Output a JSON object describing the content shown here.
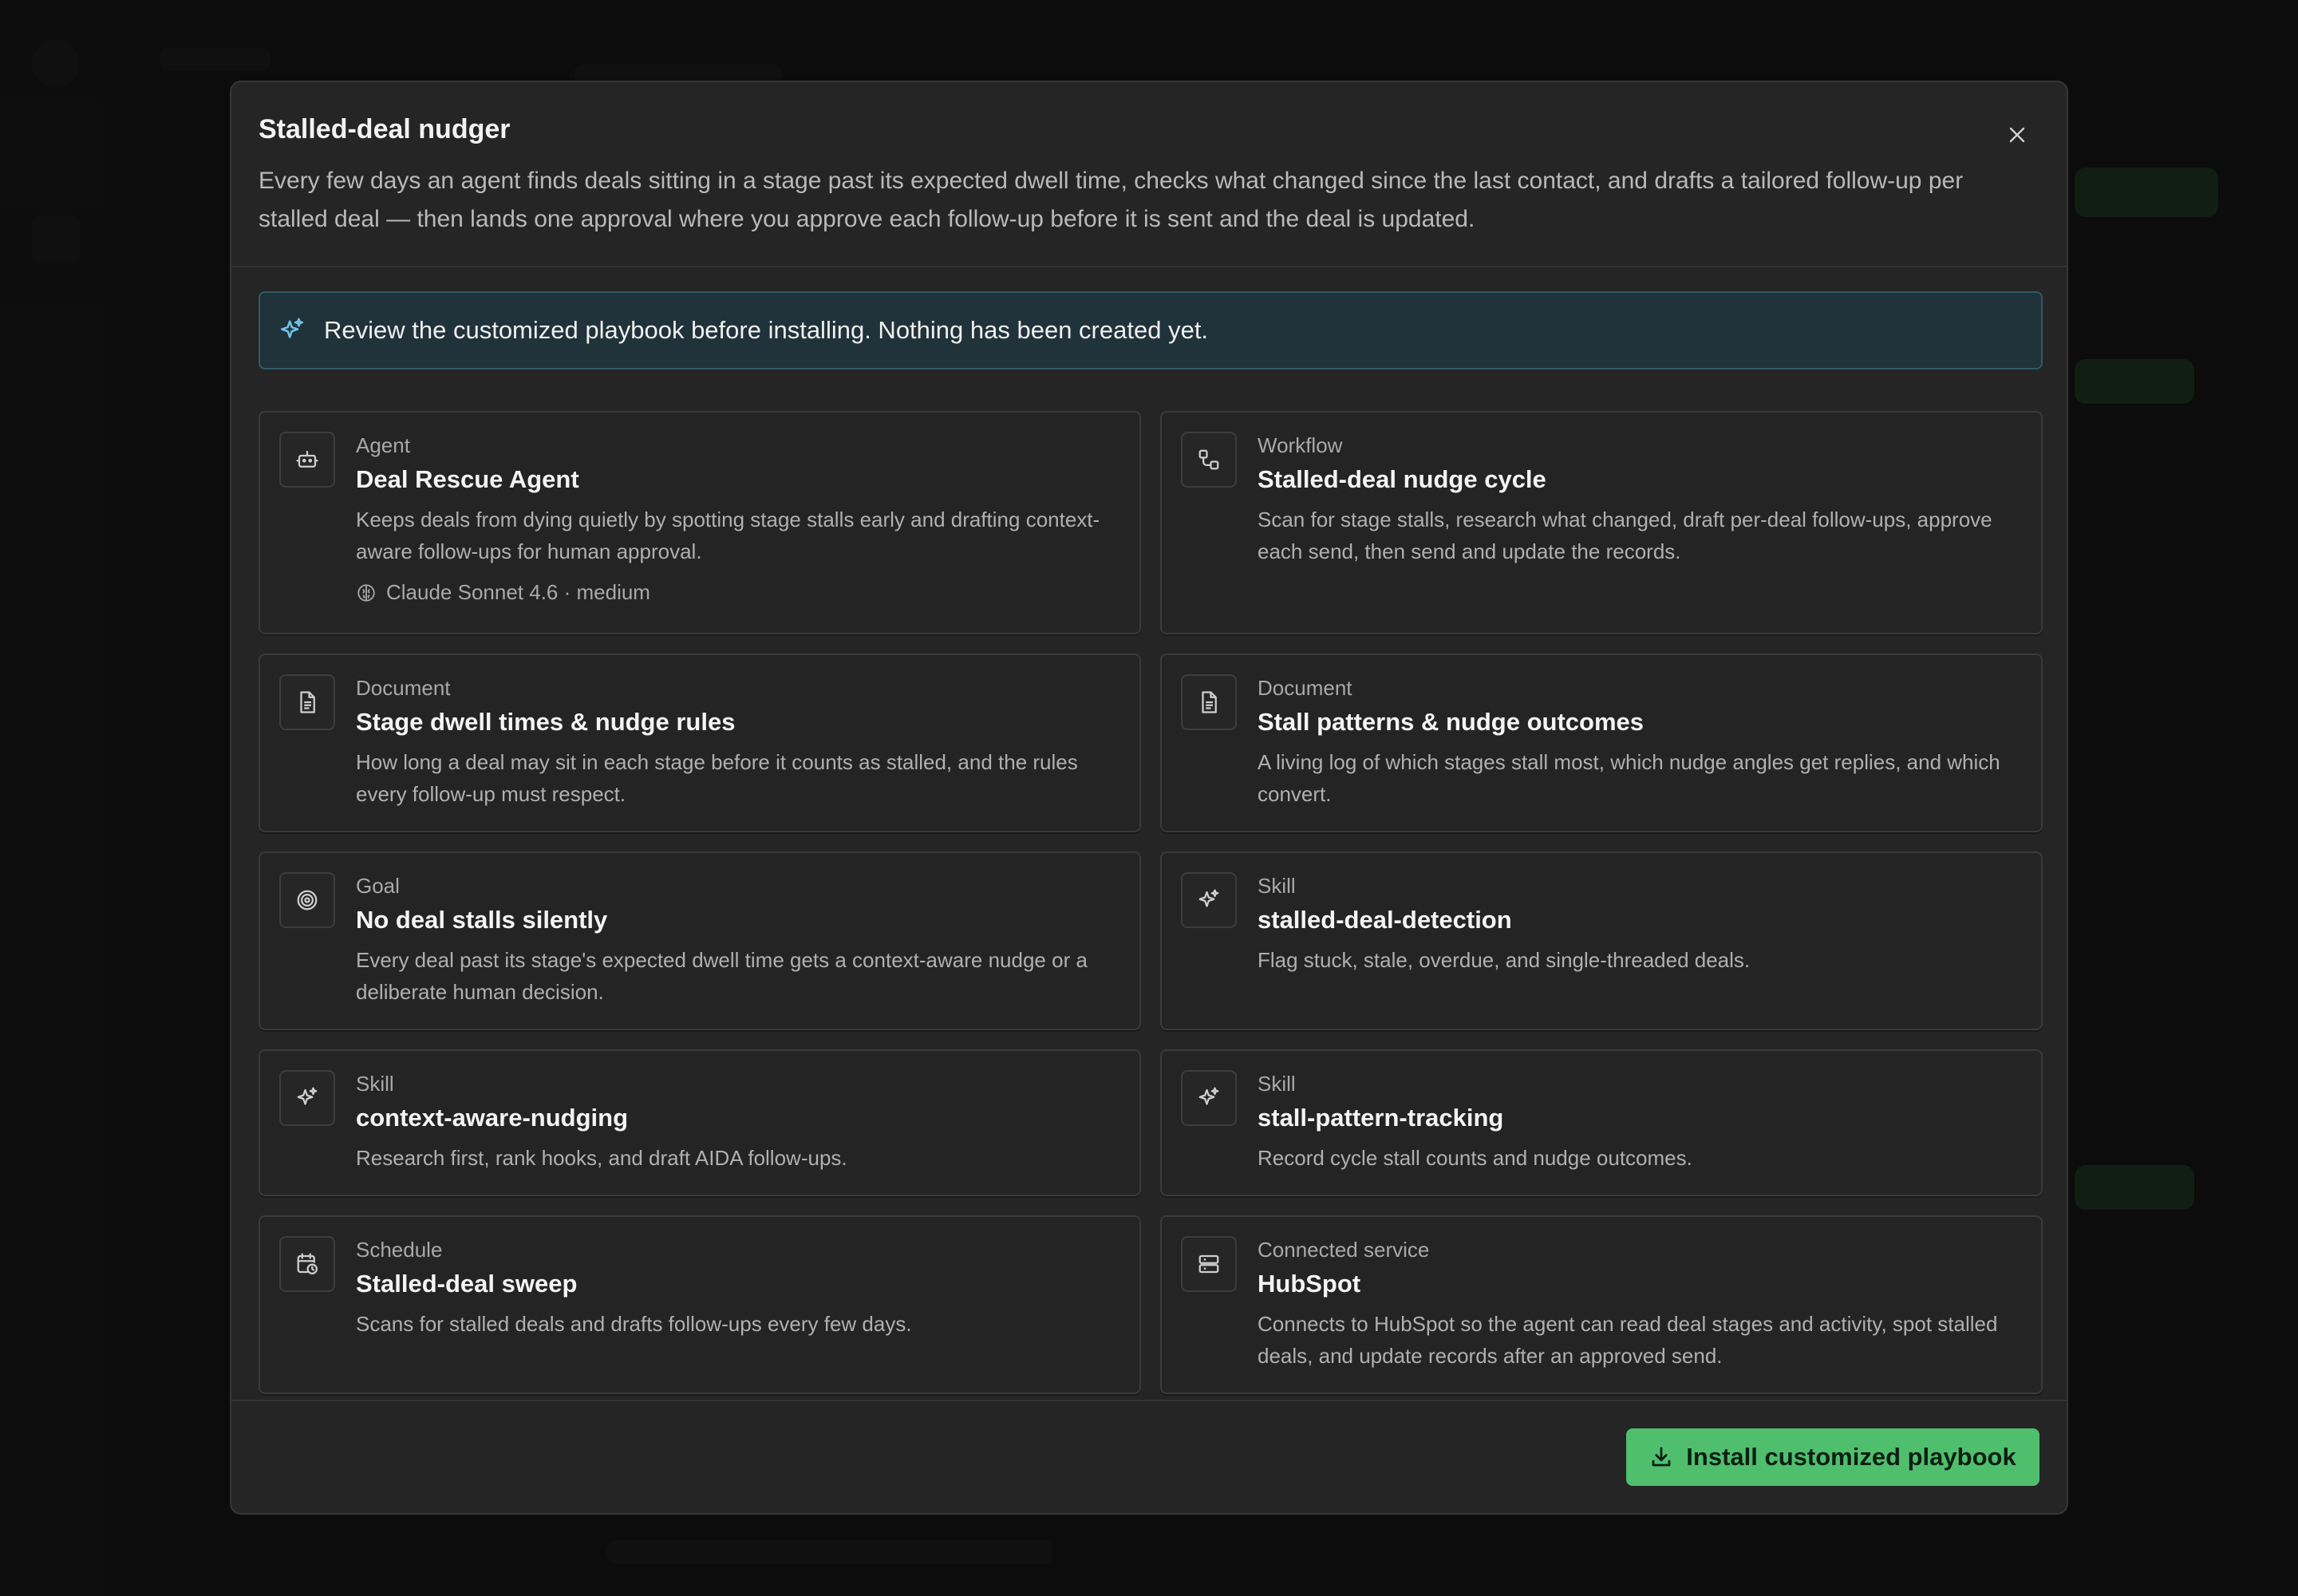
{
  "modal": {
    "title": "Stalled-deal nudger",
    "description": "Every few days an agent finds deals sitting in a stage past its expected dwell time, checks what changed since the last contact, and drafts a tailored follow-up per stalled deal — then lands one approval where you approve each follow-up before it is sent and the deal is updated.",
    "notice": "Review the customized playbook before installing. Nothing has been created yet.",
    "install_label": "Install customized playbook"
  },
  "cards": [
    {
      "type": "Agent",
      "title": "Deal Rescue Agent",
      "description": "Keeps deals from dying quietly by spotting stage stalls early and drafting context-aware follow-ups for human approval.",
      "meta": "Claude Sonnet 4.6 · medium",
      "icon": "robot-icon"
    },
    {
      "type": "Workflow",
      "title": "Stalled-deal nudge cycle",
      "description": "Scan for stage stalls, research what changed, draft per-deal follow-ups, approve each send, then send and update the records.",
      "icon": "workflow-icon"
    },
    {
      "type": "Document",
      "title": "Stage dwell times & nudge rules",
      "description": "How long a deal may sit in each stage before it counts as stalled, and the rules every follow-up must respect.",
      "icon": "document-icon"
    },
    {
      "type": "Document",
      "title": "Stall patterns & nudge outcomes",
      "description": "A living log of which stages stall most, which nudge angles get replies, and which convert.",
      "icon": "document-icon"
    },
    {
      "type": "Goal",
      "title": "No deal stalls silently",
      "description": "Every deal past its stage's expected dwell time gets a context-aware nudge or a deliberate human decision.",
      "icon": "target-icon"
    },
    {
      "type": "Skill",
      "title": "stalled-deal-detection",
      "description": "Flag stuck, stale, overdue, and single-threaded deals.",
      "icon": "sparkle-icon"
    },
    {
      "type": "Skill",
      "title": "context-aware-nudging",
      "description": "Research first, rank hooks, and draft AIDA follow-ups.",
      "icon": "sparkle-icon"
    },
    {
      "type": "Skill",
      "title": "stall-pattern-tracking",
      "description": "Record cycle stall counts and nudge outcomes.",
      "icon": "sparkle-icon"
    },
    {
      "type": "Schedule",
      "title": "Stalled-deal sweep",
      "description": "Scans for stalled deals and drafts follow-ups every few days.",
      "icon": "calendar-clock-icon"
    },
    {
      "type": "Connected service",
      "title": "HubSpot",
      "description": "Connects to HubSpot so the agent can read deal stages and activity, spot stalled deals, and update records after an approved send.",
      "icon": "server-icon"
    }
  ],
  "colors": {
    "accent": "#4fbf6e",
    "notice_bg": "#20323a",
    "notice_border": "#2e5a68",
    "modal_bg": "#252525"
  }
}
